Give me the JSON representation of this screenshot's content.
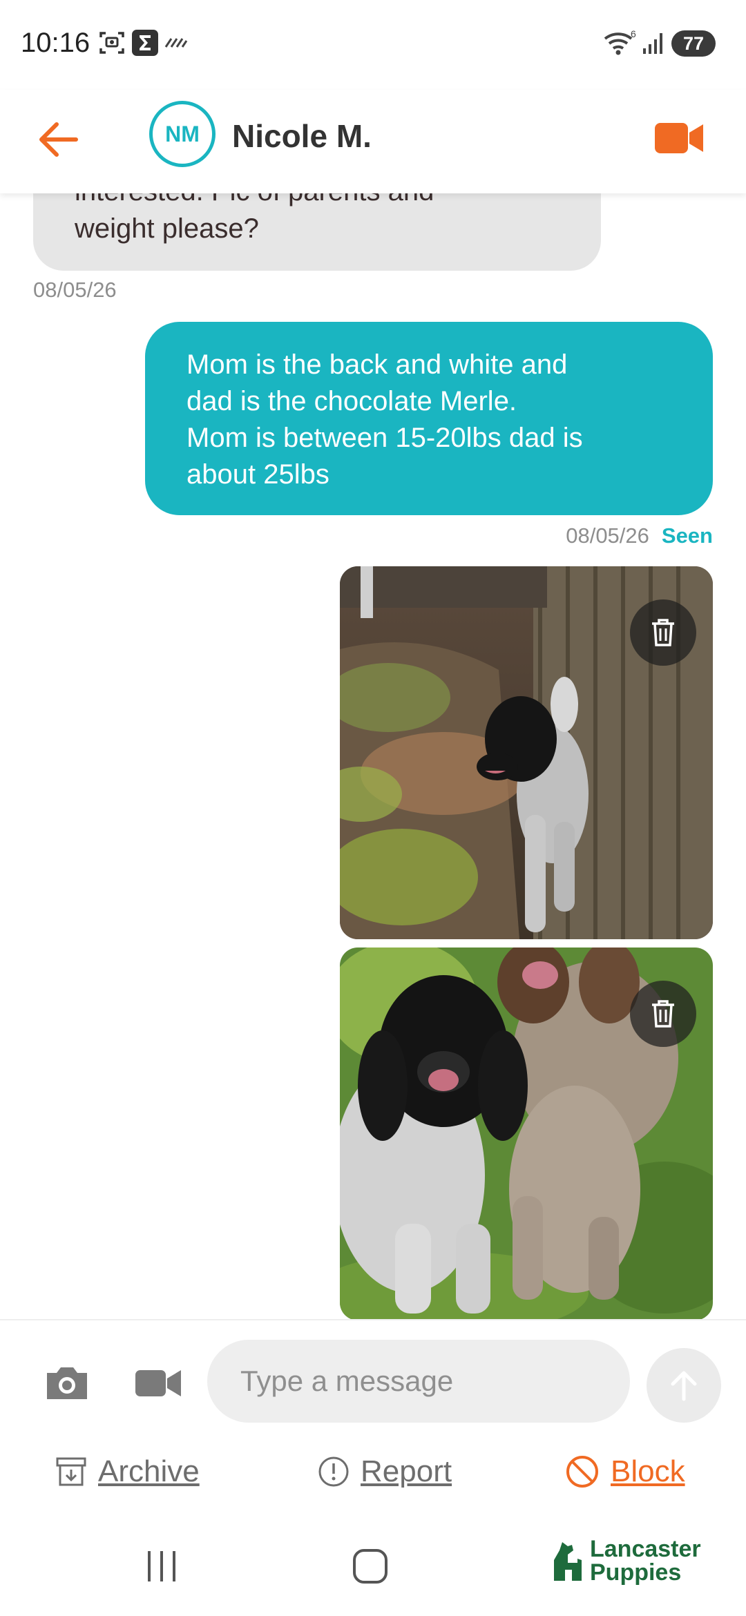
{
  "status_bar": {
    "time": "10:16",
    "wifi_badge": "6",
    "battery": "77",
    "icons": [
      "screenshot-icon",
      "sigma-app-icon",
      "tilde-icon",
      "wifi-icon",
      "signal-icon",
      "battery-icon"
    ]
  },
  "header": {
    "avatar_initials": "NM",
    "contact_name": "Nicole M.",
    "accent_color": "#f06a23",
    "avatar_color": "#1ab5c1"
  },
  "messages": {
    "incoming_text": "interested. Pic of parents and\nweight please?",
    "incoming_time": "08/05/26",
    "outgoing_text": "Mom is the back and white and\ndad is the chocolate Merle.\nMom is between 15-20lbs dad is\nabout 25lbs",
    "outgoing_time": "08/05/26",
    "outgoing_status": "Seen",
    "photos": [
      {
        "description_icon": "photo-black-white-poodle"
      },
      {
        "description_icon": "photo-two-poodles"
      }
    ]
  },
  "composer": {
    "placeholder": "Type a message"
  },
  "actions": {
    "archive": "Archive",
    "report": "Report",
    "block": "Block"
  },
  "brand": {
    "line1": "Lancaster",
    "line2": "Puppies"
  }
}
